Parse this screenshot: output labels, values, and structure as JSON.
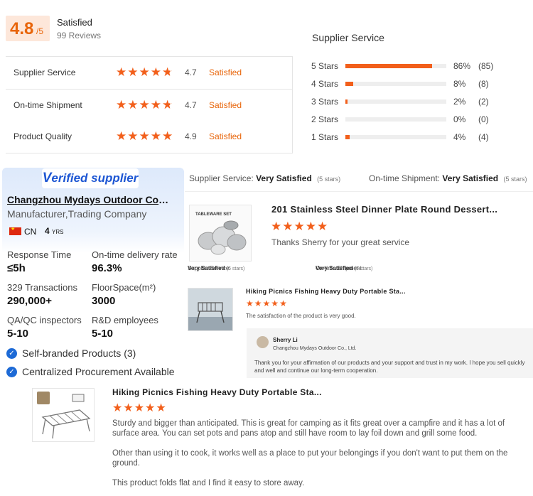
{
  "summary": {
    "score": "4.8",
    "score_max": "/5",
    "title": "Satisfied",
    "reviews": "99 Reviews"
  },
  "ratings": [
    {
      "label": "Supplier Service",
      "score": "4.7",
      "stars": 4.7,
      "text": "Satisfied"
    },
    {
      "label": "On-time Shipment",
      "score": "4.7",
      "stars": 4.7,
      "text": "Satisfied"
    },
    {
      "label": "Product Quality",
      "score": "4.9",
      "stars": 4.9,
      "text": "Satisfied"
    }
  ],
  "distribution": {
    "title": "Supplier Service",
    "rows": [
      {
        "label": "5 Stars",
        "pct": "86%",
        "count": "(85)",
        "fraction": 0.86
      },
      {
        "label": "4 Stars",
        "pct": "8%",
        "count": "(8)",
        "fraction": 0.08
      },
      {
        "label": "3 Stars",
        "pct": "2%",
        "count": "(2)",
        "fraction": 0.02
      },
      {
        "label": "2 Stars",
        "pct": "0%",
        "count": "(0)",
        "fraction": 0.0
      },
      {
        "label": "1 Stars",
        "pct": "4%",
        "count": "(4)",
        "fraction": 0.04
      }
    ]
  },
  "supplier": {
    "badge_v": "V",
    "badge_rest": "erified supplier",
    "name": "Changzhou Mydays Outdoor Co., Ltd.",
    "type": "Manufacturer,Trading Company",
    "country": "CN",
    "years_num": "4",
    "years_unit": "YRS",
    "metrics": [
      {
        "key": "Response Time",
        "value": "≤5h"
      },
      {
        "key": "On-time delivery rate",
        "value": "96.3%"
      },
      {
        "key": "329 Transactions",
        "value": "290,000+"
      },
      {
        "key": "FloorSpace(m²)",
        "value": "3000"
      },
      {
        "key": "QA/QC inspectors",
        "value": "5-10"
      },
      {
        "key": "R&D employees",
        "value": "5-10"
      }
    ],
    "features": [
      "Self-branded Products (3)",
      "Centralized Procurement Available"
    ]
  },
  "review_header": {
    "service_label": "Supplier Service:",
    "service_value": "Very Satisfied",
    "service_stars": "(5 stars)",
    "shipment_label": "On-time Shipment:",
    "shipment_value": "Very Satisfied",
    "shipment_stars": "(5 stars)"
  },
  "reviews": [
    {
      "title": "201 Stainless Steel Dinner Plate Round Dessert...",
      "text": "Thanks Sherry for your great service",
      "thumb_label": "TABLEWARE SET",
      "meta_service_label": "Supplier Service:",
      "meta_service_value": "Very Satisfied",
      "meta_service_stars": "(5 stars)",
      "meta_shipment_label": "On-time Shipment:",
      "meta_shipment_value": "Very Satisfied",
      "meta_shipment_stars": "(5 stars)"
    },
    {
      "title": "Hiking Picnics Fishing Heavy Duty Portable Sta...",
      "text": "The satisfaction of the product is very good.",
      "reply": {
        "name": "Sherry Li",
        "company": "Changzhou Mydays Outdoor Co., Ltd.",
        "text": "Thank you for your affirmation of our products and your support and trust in my work. I hope you sell quickly and well and continue our long-term cooperation."
      }
    },
    {
      "title": "Hiking Picnics Fishing Heavy Duty Portable Sta...",
      "paragraphs": [
        "Sturdy and bigger than anticipated. This is great for camping as it fits great over a campfire and it has a lot of surface area. You can set pots and pans atop and still have room to lay foil down and grill some food.",
        "Other than using it to cook, it works well as a place to put your belongings if you don't want to put them on the ground.",
        "This product folds flat and I find it easy to store away."
      ]
    }
  ],
  "colors": {
    "accent": "#f25f1b",
    "link_blue": "#1d56d3",
    "card_bg": "#eef4fd"
  }
}
